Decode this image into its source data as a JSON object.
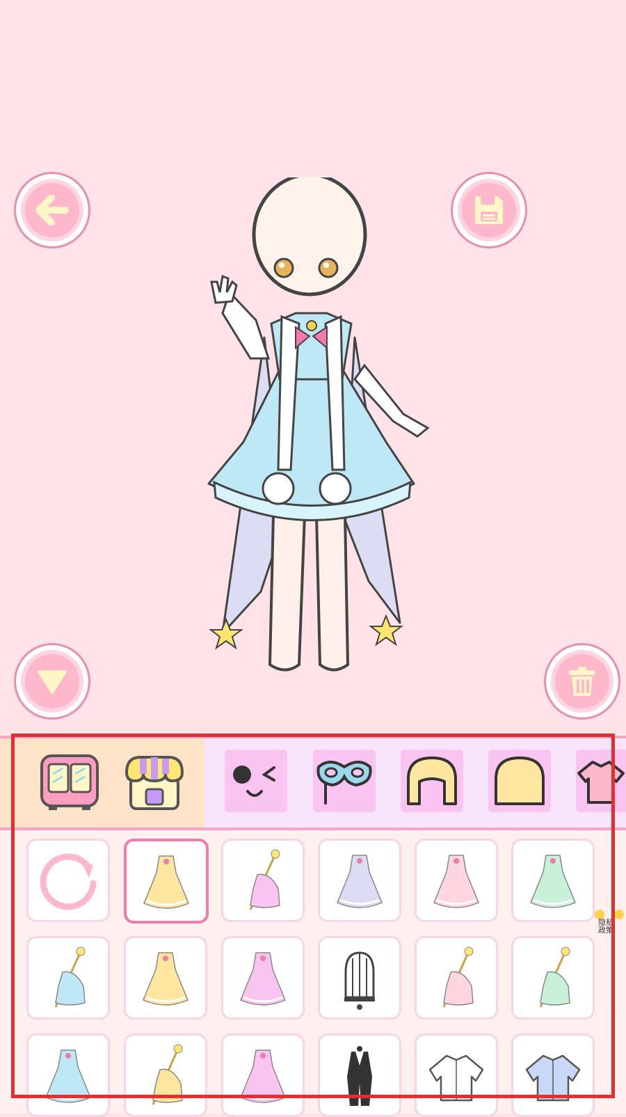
{
  "buttons": {
    "back_icon": "back-arrow-icon",
    "save_icon": "floppy-disk-icon",
    "collapse_icon": "triangle-down-icon",
    "trash_icon": "trash-icon"
  },
  "colors": {
    "background": "#ffe3e8",
    "button_fill": "#ffb7cb",
    "accent_border": "#e88fb0",
    "category_bar": "#f8e4fb",
    "shop_area": "#ffe3c8",
    "tab_fill": "#f9c4f0",
    "selected_border": "#f07aa8",
    "frame_red": "#e03030"
  },
  "shop": [
    {
      "icon": "wardrobe-icon"
    },
    {
      "icon": "store-icon"
    }
  ],
  "categories": [
    {
      "icon": "face-wink-icon"
    },
    {
      "icon": "eye-mask-icon"
    },
    {
      "icon": "hair-outline-icon"
    },
    {
      "icon": "hair-fill-icon"
    },
    {
      "icon": "shirt-icon"
    }
  ],
  "items": [
    {
      "icon": "reset-icon",
      "selected": false
    },
    {
      "icon": "blue-cape-dress-icon",
      "selected": true
    },
    {
      "icon": "staff-dress-icon",
      "selected": false
    },
    {
      "icon": "blue-ballgown-icon",
      "selected": false
    },
    {
      "icon": "yellow-gown-icon",
      "selected": false
    },
    {
      "icon": "pink-flower-gown-icon",
      "selected": false
    },
    {
      "icon": "flower-wand-icon",
      "selected": false
    },
    {
      "icon": "white-gown-icon",
      "selected": false
    },
    {
      "icon": "pastel-gown-icon",
      "selected": false
    },
    {
      "icon": "birdcage-icon",
      "selected": false
    },
    {
      "icon": "wing-staff-dress-icon",
      "selected": false
    },
    {
      "icon": "rose-wand-icon",
      "selected": false
    },
    {
      "icon": "fairy-dress-icon",
      "selected": false
    },
    {
      "icon": "star-wand-icon",
      "selected": false
    },
    {
      "icon": "pink-layered-gown-icon",
      "selected": false
    },
    {
      "icon": "tuxedo-icon",
      "selected": false
    },
    {
      "icon": "white-jacket-icon",
      "selected": false
    },
    {
      "icon": "blue-shirt-icon",
      "selected": false
    }
  ],
  "side_badge": "隐私政策"
}
